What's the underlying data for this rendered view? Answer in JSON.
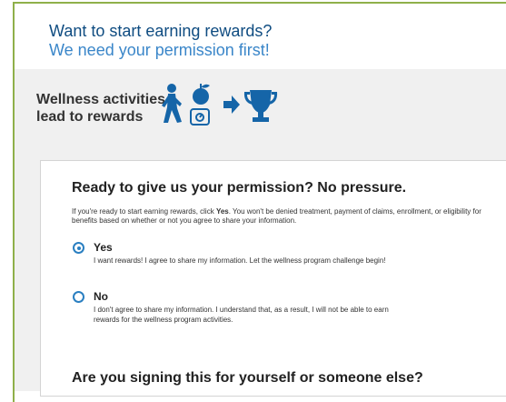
{
  "header": {
    "title_line1": "Want to start earning rewards?",
    "title_line2": "We need your permission first!"
  },
  "banner": {
    "line1": "Wellness activities",
    "line2": "lead to rewards",
    "icons": [
      "walking-person-icon",
      "apple-icon",
      "scale-icon",
      "arrow-right-icon",
      "trophy-icon"
    ]
  },
  "permission": {
    "heading": "Ready to give us your permission? No pressure.",
    "intro_before": "If you're ready to start earning rewards, click ",
    "intro_bold": "Yes",
    "intro_after": ". You won't be denied treatment, payment of claims, enrollment, or eligibility for benefits based on whether or not you agree to share your information.",
    "options": [
      {
        "label": "Yes",
        "selected": true,
        "description": "I want rewards! I agree to share my information. Let the wellness program challenge begin!"
      },
      {
        "label": "No",
        "selected": false,
        "description": "I don't agree to share my information. I understand that, as a result, I will not be able to earn rewards for the wellness program activities."
      }
    ]
  },
  "signing": {
    "heading": "Are you signing this for yourself or someone else?"
  },
  "colors": {
    "frame_border": "#8fb04a",
    "title_dark": "#0f4c81",
    "title_light": "#3a86c9",
    "icon_blue": "#1565a8",
    "radio_blue": "#2a7fc1"
  }
}
